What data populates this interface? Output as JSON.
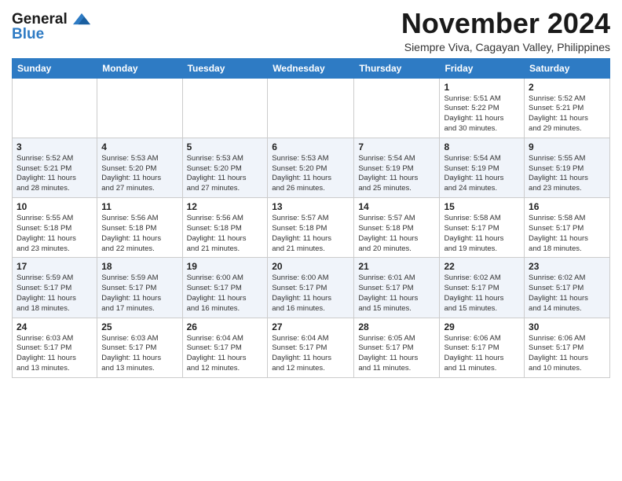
{
  "logo": {
    "line1": "General",
    "line2": "Blue"
  },
  "title": "November 2024",
  "subtitle": "Siempre Viva, Cagayan Valley, Philippines",
  "weekdays": [
    "Sunday",
    "Monday",
    "Tuesday",
    "Wednesday",
    "Thursday",
    "Friday",
    "Saturday"
  ],
  "weeks": [
    [
      {
        "day": "",
        "info": ""
      },
      {
        "day": "",
        "info": ""
      },
      {
        "day": "",
        "info": ""
      },
      {
        "day": "",
        "info": ""
      },
      {
        "day": "",
        "info": ""
      },
      {
        "day": "1",
        "info": "Sunrise: 5:51 AM\nSunset: 5:22 PM\nDaylight: 11 hours\nand 30 minutes."
      },
      {
        "day": "2",
        "info": "Sunrise: 5:52 AM\nSunset: 5:21 PM\nDaylight: 11 hours\nand 29 minutes."
      }
    ],
    [
      {
        "day": "3",
        "info": "Sunrise: 5:52 AM\nSunset: 5:21 PM\nDaylight: 11 hours\nand 28 minutes."
      },
      {
        "day": "4",
        "info": "Sunrise: 5:53 AM\nSunset: 5:20 PM\nDaylight: 11 hours\nand 27 minutes."
      },
      {
        "day": "5",
        "info": "Sunrise: 5:53 AM\nSunset: 5:20 PM\nDaylight: 11 hours\nand 27 minutes."
      },
      {
        "day": "6",
        "info": "Sunrise: 5:53 AM\nSunset: 5:20 PM\nDaylight: 11 hours\nand 26 minutes."
      },
      {
        "day": "7",
        "info": "Sunrise: 5:54 AM\nSunset: 5:19 PM\nDaylight: 11 hours\nand 25 minutes."
      },
      {
        "day": "8",
        "info": "Sunrise: 5:54 AM\nSunset: 5:19 PM\nDaylight: 11 hours\nand 24 minutes."
      },
      {
        "day": "9",
        "info": "Sunrise: 5:55 AM\nSunset: 5:19 PM\nDaylight: 11 hours\nand 23 minutes."
      }
    ],
    [
      {
        "day": "10",
        "info": "Sunrise: 5:55 AM\nSunset: 5:18 PM\nDaylight: 11 hours\nand 23 minutes."
      },
      {
        "day": "11",
        "info": "Sunrise: 5:56 AM\nSunset: 5:18 PM\nDaylight: 11 hours\nand 22 minutes."
      },
      {
        "day": "12",
        "info": "Sunrise: 5:56 AM\nSunset: 5:18 PM\nDaylight: 11 hours\nand 21 minutes."
      },
      {
        "day": "13",
        "info": "Sunrise: 5:57 AM\nSunset: 5:18 PM\nDaylight: 11 hours\nand 21 minutes."
      },
      {
        "day": "14",
        "info": "Sunrise: 5:57 AM\nSunset: 5:18 PM\nDaylight: 11 hours\nand 20 minutes."
      },
      {
        "day": "15",
        "info": "Sunrise: 5:58 AM\nSunset: 5:17 PM\nDaylight: 11 hours\nand 19 minutes."
      },
      {
        "day": "16",
        "info": "Sunrise: 5:58 AM\nSunset: 5:17 PM\nDaylight: 11 hours\nand 18 minutes."
      }
    ],
    [
      {
        "day": "17",
        "info": "Sunrise: 5:59 AM\nSunset: 5:17 PM\nDaylight: 11 hours\nand 18 minutes."
      },
      {
        "day": "18",
        "info": "Sunrise: 5:59 AM\nSunset: 5:17 PM\nDaylight: 11 hours\nand 17 minutes."
      },
      {
        "day": "19",
        "info": "Sunrise: 6:00 AM\nSunset: 5:17 PM\nDaylight: 11 hours\nand 16 minutes."
      },
      {
        "day": "20",
        "info": "Sunrise: 6:00 AM\nSunset: 5:17 PM\nDaylight: 11 hours\nand 16 minutes."
      },
      {
        "day": "21",
        "info": "Sunrise: 6:01 AM\nSunset: 5:17 PM\nDaylight: 11 hours\nand 15 minutes."
      },
      {
        "day": "22",
        "info": "Sunrise: 6:02 AM\nSunset: 5:17 PM\nDaylight: 11 hours\nand 15 minutes."
      },
      {
        "day": "23",
        "info": "Sunrise: 6:02 AM\nSunset: 5:17 PM\nDaylight: 11 hours\nand 14 minutes."
      }
    ],
    [
      {
        "day": "24",
        "info": "Sunrise: 6:03 AM\nSunset: 5:17 PM\nDaylight: 11 hours\nand 13 minutes."
      },
      {
        "day": "25",
        "info": "Sunrise: 6:03 AM\nSunset: 5:17 PM\nDaylight: 11 hours\nand 13 minutes."
      },
      {
        "day": "26",
        "info": "Sunrise: 6:04 AM\nSunset: 5:17 PM\nDaylight: 11 hours\nand 12 minutes."
      },
      {
        "day": "27",
        "info": "Sunrise: 6:04 AM\nSunset: 5:17 PM\nDaylight: 11 hours\nand 12 minutes."
      },
      {
        "day": "28",
        "info": "Sunrise: 6:05 AM\nSunset: 5:17 PM\nDaylight: 11 hours\nand 11 minutes."
      },
      {
        "day": "29",
        "info": "Sunrise: 6:06 AM\nSunset: 5:17 PM\nDaylight: 11 hours\nand 11 minutes."
      },
      {
        "day": "30",
        "info": "Sunrise: 6:06 AM\nSunset: 5:17 PM\nDaylight: 11 hours\nand 10 minutes."
      }
    ]
  ]
}
